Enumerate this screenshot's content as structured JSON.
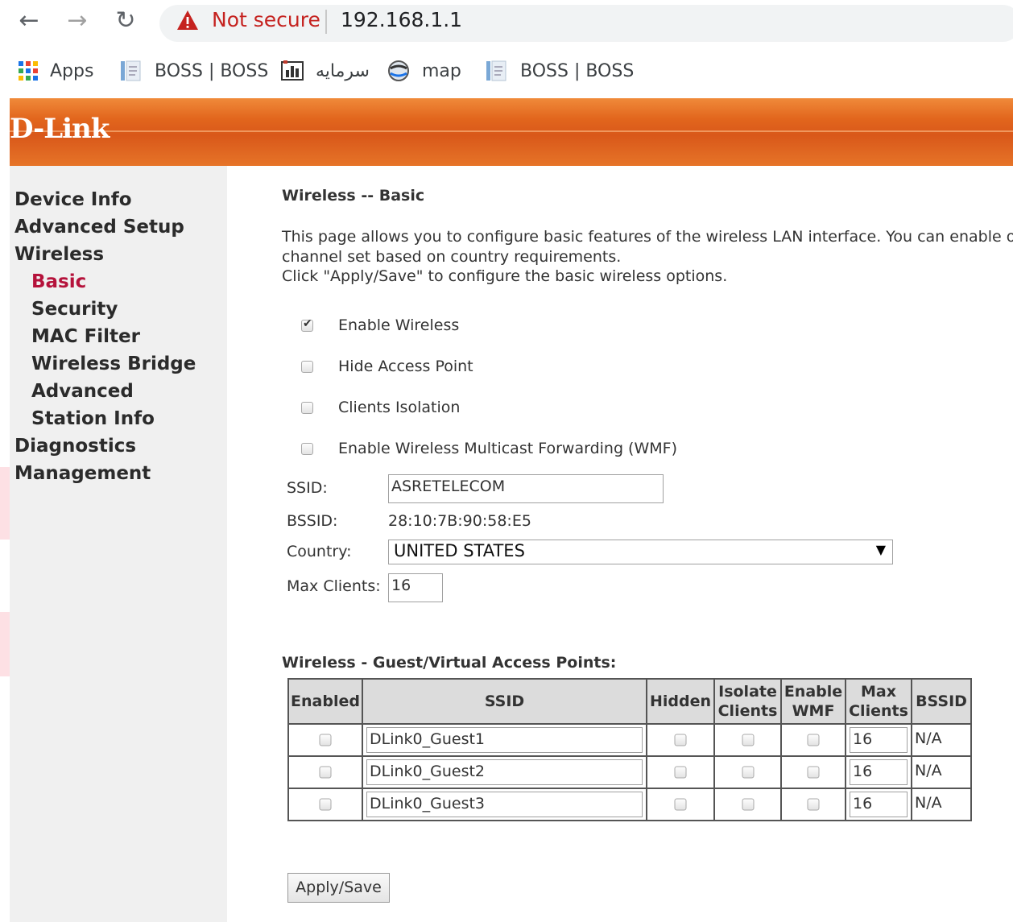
{
  "browser": {
    "security_label": "Not secure",
    "url": "192.168.1.1",
    "bookmarks": [
      {
        "label": "Apps",
        "icon": "apps-grid-icon"
      },
      {
        "label": "BOSS | BOSS",
        "icon": "page-icon"
      },
      {
        "label": "سرمایه",
        "icon": "chart-icon"
      },
      {
        "label": "map",
        "icon": "map-icon"
      },
      {
        "label": "BOSS | BOSS",
        "icon": "page-icon"
      }
    ]
  },
  "header": {
    "logo": "D-Link",
    "brand_color": "#e2661d"
  },
  "sidebar": {
    "items": [
      {
        "label": "Device Info"
      },
      {
        "label": "Advanced Setup"
      },
      {
        "label": "Wireless"
      },
      {
        "label": "Basic",
        "active": true
      },
      {
        "label": "Security"
      },
      {
        "label": "MAC Filter"
      },
      {
        "label": "Wireless Bridge"
      },
      {
        "label": "Advanced"
      },
      {
        "label": "Station Info"
      },
      {
        "label": "Diagnostics"
      },
      {
        "label": "Management"
      }
    ],
    "active_color": "#b5123b"
  },
  "main": {
    "title": "Wireless -- Basic",
    "description": [
      "This page allows you to configure basic features of the wireless LAN interface. You can enable or disa",
      "channel set based on country requirements.",
      "Click \"Apply/Save\" to configure the basic wireless options."
    ],
    "options": [
      {
        "label": "Enable Wireless",
        "checked": true
      },
      {
        "label": "Hide Access Point",
        "checked": false
      },
      {
        "label": "Clients Isolation",
        "checked": false
      },
      {
        "label": "Enable Wireless Multicast Forwarding (WMF)",
        "checked": false
      }
    ],
    "fields": {
      "ssid_label": "SSID:",
      "ssid_value": "ASRETELECOM",
      "bssid_label": "BSSID:",
      "bssid_value": "28:10:7B:90:58:E5",
      "country_label": "Country:",
      "country_value": "UNITED STATES",
      "max_clients_label": "Max Clients:",
      "max_clients_value": "16"
    },
    "guest_title": "Wireless - Guest/Virtual Access Points:",
    "guest_table": {
      "headers": [
        "Enabled",
        "SSID",
        "Hidden",
        "Isolate Clients",
        "Enable WMF",
        "Max Clients",
        "BSSID"
      ],
      "rows": [
        {
          "enabled": false,
          "ssid": "DLink0_Guest1",
          "hidden": false,
          "isolate": false,
          "wmf": false,
          "max_clients": "16",
          "bssid": "N/A"
        },
        {
          "enabled": false,
          "ssid": "DLink0_Guest2",
          "hidden": false,
          "isolate": false,
          "wmf": false,
          "max_clients": "16",
          "bssid": "N/A"
        },
        {
          "enabled": false,
          "ssid": "DLink0_Guest3",
          "hidden": false,
          "isolate": false,
          "wmf": false,
          "max_clients": "16",
          "bssid": "N/A"
        }
      ]
    },
    "apply_label": "Apply/Save"
  }
}
